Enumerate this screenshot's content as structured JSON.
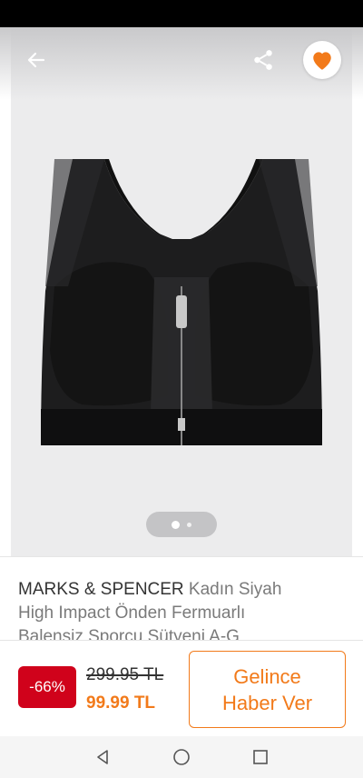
{
  "product": {
    "brand": "MARKS & SPENCER",
    "title_line1": " Kadın Siyah",
    "title_line2": "High Impact Önden Fermuarlı",
    "title_line3": "Balensiz Sporcu Sütyeni A-G"
  },
  "pricing": {
    "discount": "-66%",
    "old_price": "299.95 TL",
    "new_price": "99.99 TL"
  },
  "actions": {
    "notify_line1": "Gelince",
    "notify_line2": "Haber Ver"
  },
  "gallery": {
    "current_page": 1,
    "total_pages": 2
  },
  "icons": {
    "back": "arrow-left-icon",
    "share": "share-icon",
    "favorite": "heart-icon",
    "nav_back": "triangle-back-icon",
    "nav_home": "circle-home-icon",
    "nav_recent": "square-recent-icon"
  },
  "colors": {
    "accent": "#f27a1a",
    "discount": "#d0021b"
  }
}
